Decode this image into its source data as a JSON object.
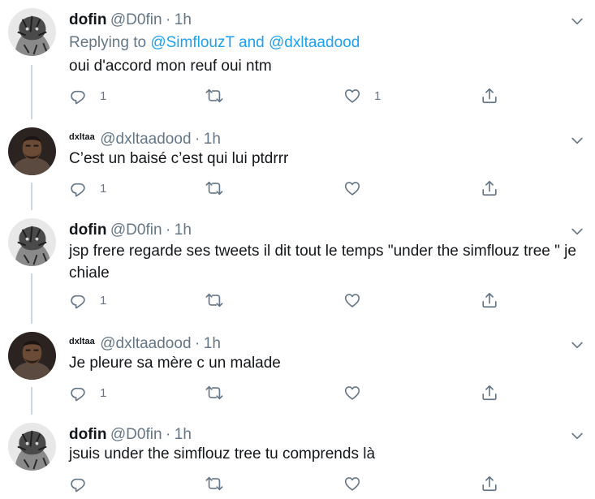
{
  "tweets": [
    {
      "name": "dofin",
      "handle": "@D0fin",
      "dot": "·",
      "time": "1h",
      "replying_prefix": "Replying to ",
      "replying_user1": "@SimflouzT",
      "replying_and": " and ",
      "replying_user2": "@dxltaadood",
      "text": "oui d'accord mon reuf oui ntm",
      "reply_count": "1",
      "retweet_count": "",
      "like_count": "1"
    },
    {
      "name": "dxltaa",
      "handle": "@dxltaadood",
      "dot": "·",
      "time": "1h",
      "text": "C’est un baisé c’est qui lui ptdrrr",
      "reply_count": "1",
      "retweet_count": "",
      "like_count": ""
    },
    {
      "name": "dofin",
      "handle": "@D0fin",
      "dot": "·",
      "time": "1h",
      "text": "jsp frere regarde ses tweets il dit tout le temps \"under the simflouz tree \" je chiale",
      "reply_count": "1",
      "retweet_count": "",
      "like_count": ""
    },
    {
      "name": "dxltaa",
      "handle": "@dxltaadood",
      "dot": "·",
      "time": "1h",
      "text": "Je pleure sa mère c un malade",
      "reply_count": "1",
      "retweet_count": "",
      "like_count": ""
    },
    {
      "name": "dofin",
      "handle": "@D0fin",
      "dot": "·",
      "time": "1h",
      "text": "jsuis under the simflouz tree tu comprends là",
      "reply_count": "",
      "retweet_count": "",
      "like_count": ""
    }
  ],
  "icons": {
    "reply": "reply-icon",
    "retweet": "retweet-icon",
    "like": "heart-icon",
    "share": "share-icon",
    "more": "chevron-down-icon"
  },
  "colors": {
    "link": "#1da1f2",
    "secondary_text": "#657786",
    "primary_text": "#14171a",
    "divider": "#e6ecf0",
    "thread_line": "#ccd6dd"
  }
}
